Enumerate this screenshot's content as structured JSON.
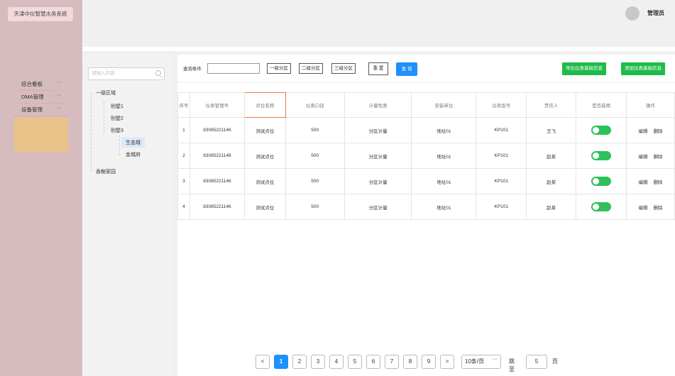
{
  "app": {
    "title": "天津中仪智慧水务系统"
  },
  "menu": {
    "items": [
      {
        "label": "综合看板"
      },
      {
        "label": "DMA管理"
      },
      {
        "label": "设备管理"
      }
    ]
  },
  "header": {
    "user": "管理员"
  },
  "tree": {
    "search_placeholder": "请输入内容",
    "root": "一级区域",
    "n1": "别墅1",
    "n2": "别墅2",
    "n3": "别墅3",
    "n3a": "生态城",
    "n3b": "金城府",
    "other": "香榭家园"
  },
  "filter": {
    "label": "查询条件",
    "lvl1": "一级分区",
    "lvl2": "二级分区",
    "lvl3": "三级分区",
    "reset": "重 置",
    "query": "查 询",
    "export": "导出仪表基础信息",
    "add": "添加仪表基础信息"
  },
  "table": {
    "headers": [
      "序号",
      "仪表管理号",
      "点位名称",
      "仪表口径",
      "计量性质",
      "安装单位",
      "仪表型号",
      "责任人",
      "是否启用",
      "操作"
    ],
    "rows": [
      {
        "no": "1",
        "id": "83085221146",
        "point": "测试点位",
        "caliber": "500",
        "nature": "分区计量",
        "unit": "地址01",
        "model": "KP101",
        "owner": "王飞"
      },
      {
        "no": "2",
        "id": "83085221146",
        "point": "测试点位",
        "caliber": "500",
        "nature": "分区计量",
        "unit": "地址01",
        "model": "KP101",
        "owner": "赵某"
      },
      {
        "no": "3",
        "id": "83085221146",
        "point": "测试点位",
        "caliber": "500",
        "nature": "分区计量",
        "unit": "地址01",
        "model": "KP101",
        "owner": "赵某"
      },
      {
        "no": "4",
        "id": "83085221146",
        "point": "测试点位",
        "caliber": "500",
        "nature": "分区计量",
        "unit": "地址01",
        "model": "KP101",
        "owner": "赵某"
      }
    ],
    "edit": "编辑",
    "delete": "删除"
  },
  "pager": {
    "prev": "<",
    "next": ">",
    "pages": [
      "1",
      "2",
      "3",
      "4",
      "5",
      "6",
      "7",
      "8",
      "9"
    ],
    "page_size": "10条/页",
    "jump_label": "跳至",
    "jump_value": "5",
    "page_suffix": "页"
  },
  "colors": {
    "accent": "#1e90ff",
    "green": "#1fbb4a",
    "sidebar": "#d6bcbf",
    "highlight": "#e57b3c"
  }
}
